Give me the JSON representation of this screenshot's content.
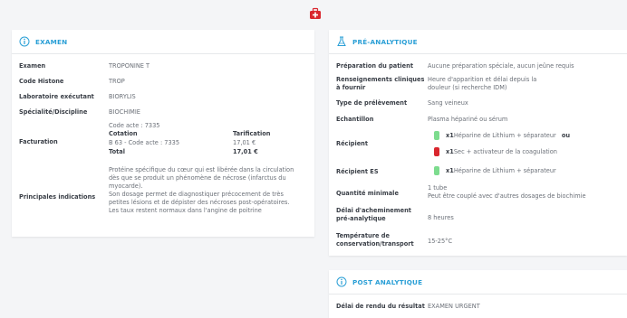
{
  "top_icon": "medical-kit-icon",
  "examen": {
    "title": "EXAMEN",
    "rows": {
      "examen": {
        "label": "Examen",
        "value": "TROPONINE T"
      },
      "code_histone": {
        "label": "Code Histone",
        "value": "TROP"
      },
      "laboratoire": {
        "label": "Laboratoire exécutant",
        "value": "BIORYLIS"
      },
      "specialite": {
        "label": "Spécialité/Discipline",
        "value": "BIOCHIMIE"
      }
    },
    "facturation": {
      "label": "Facturation",
      "code_acte": "Code acte : 7335",
      "cotation_header": "Cotation",
      "tarification_header": "Tarification",
      "cotation_value": "B 63 - Code acte : 7335",
      "tarification_value": "17,01 €",
      "total_label": "Total",
      "total_value": "17,01 €"
    },
    "indications": {
      "label": "Principales indications",
      "lines": [
        "Protéine spécifique du cœur qui est libérée dans la circulation",
        "dès que se produit un phénomène de nécrose (infarctus du",
        "myocarde).",
        "Son dosage permet de diagnostiquer précocement de très",
        "petites lésions et de dépister des nécroses post-opératoires.",
        "Les taux restent normaux dans l'angine de poitrine"
      ]
    }
  },
  "pre": {
    "title": "PRÉ-ANALYTIQUE",
    "preparation": {
      "label": "Préparation du patient",
      "value": "Aucune préparation spéciale, aucun jeûne requis"
    },
    "renseignements": {
      "label_line1": "Renseignements cliniques",
      "label_line2": "à fournir",
      "value_line1": "Heure d'apparition et délai depuis la",
      "value_line2": "douleur (si recherche IDM)"
    },
    "type": {
      "label": "Type de prélèvement",
      "value": "Sang veineux"
    },
    "echantillon": {
      "label": "Echantillon",
      "value": "Plasma hépariné ou sérum"
    },
    "recipient": {
      "label": "Récipient",
      "item1_qty": "x1",
      "item1_text": "Héparine de Lithium + séparateur",
      "item1_suffix": "ou",
      "item2_qty": "x1",
      "item2_text": "Sec + activateur de la coagulation"
    },
    "recipient_es": {
      "label": "Récipient ES",
      "qty": "x1",
      "text": "Héparine de Lithium + séparateur"
    },
    "quantite": {
      "label": "Quantité minimale",
      "value_line1": "1 tube",
      "value_line2": "Peut être couplé avec d'autres dosages de biochimie"
    },
    "delai": {
      "label_line1": "Délai d'acheminement",
      "label_line2": "pré-analytique",
      "value": "8 heures"
    },
    "temperature": {
      "label_line1": "Température de",
      "label_line2": "conservation/transport",
      "value": "15-25°C"
    },
    "colors": {
      "green_tube": "#7ddc8e",
      "red_tube": "#d9262e"
    }
  },
  "post": {
    "title": "POST ANALYTIQUE",
    "delai": {
      "label": "Délai de rendu du résultat",
      "value": "EXAMEN URGENT"
    }
  },
  "colors": {
    "accent": "#2a9fd6",
    "kit_red": "#d9262e"
  }
}
